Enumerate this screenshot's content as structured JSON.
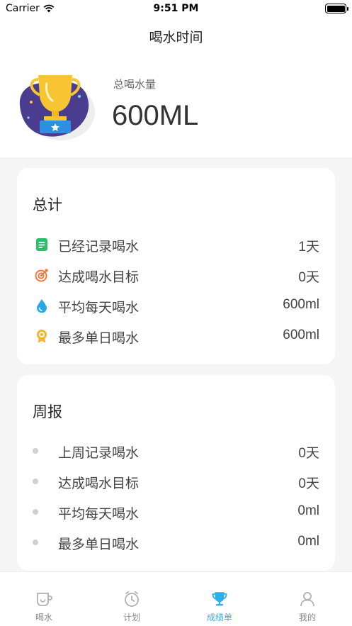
{
  "status_bar": {
    "carrier": "Carrier",
    "time": "9:51 PM"
  },
  "nav": {
    "title": "喝水时间"
  },
  "summary": {
    "label": "总喝水量",
    "value": "600ML"
  },
  "total_card": {
    "title": "总计",
    "rows": [
      {
        "icon": "record-icon",
        "label": "已经记录喝水",
        "value": "1天",
        "color": "#2bbf6a"
      },
      {
        "icon": "target-icon",
        "label": "达成喝水目标",
        "value": "0天",
        "color": "#f07a3c"
      },
      {
        "icon": "water-drop-icon",
        "label": "平均每天喝水",
        "value": "600ml",
        "color": "#27a9e6"
      },
      {
        "icon": "medal-icon",
        "label": "最多单日喝水",
        "value": "600ml",
        "color": "#f3b52b"
      }
    ]
  },
  "weekly_card": {
    "title": "周报",
    "rows": [
      {
        "label": "上周记录喝水",
        "value": "0天"
      },
      {
        "label": "达成喝水目标",
        "value": "0天"
      },
      {
        "label": "平均每天喝水",
        "value": "0ml"
      },
      {
        "label": "最多单日喝水",
        "value": "0ml"
      }
    ]
  },
  "tabs": [
    {
      "icon": "cup-icon",
      "label": "喝水",
      "active": false
    },
    {
      "icon": "clock-icon",
      "label": "计划",
      "active": false
    },
    {
      "icon": "trophy-icon",
      "label": "成绩单",
      "active": true
    },
    {
      "icon": "person-icon",
      "label": "我的",
      "active": false
    }
  ],
  "colors": {
    "accent": "#2bb0e8",
    "trophy_gold": "#f7c531",
    "trophy_bg": "#4a3d8f"
  }
}
